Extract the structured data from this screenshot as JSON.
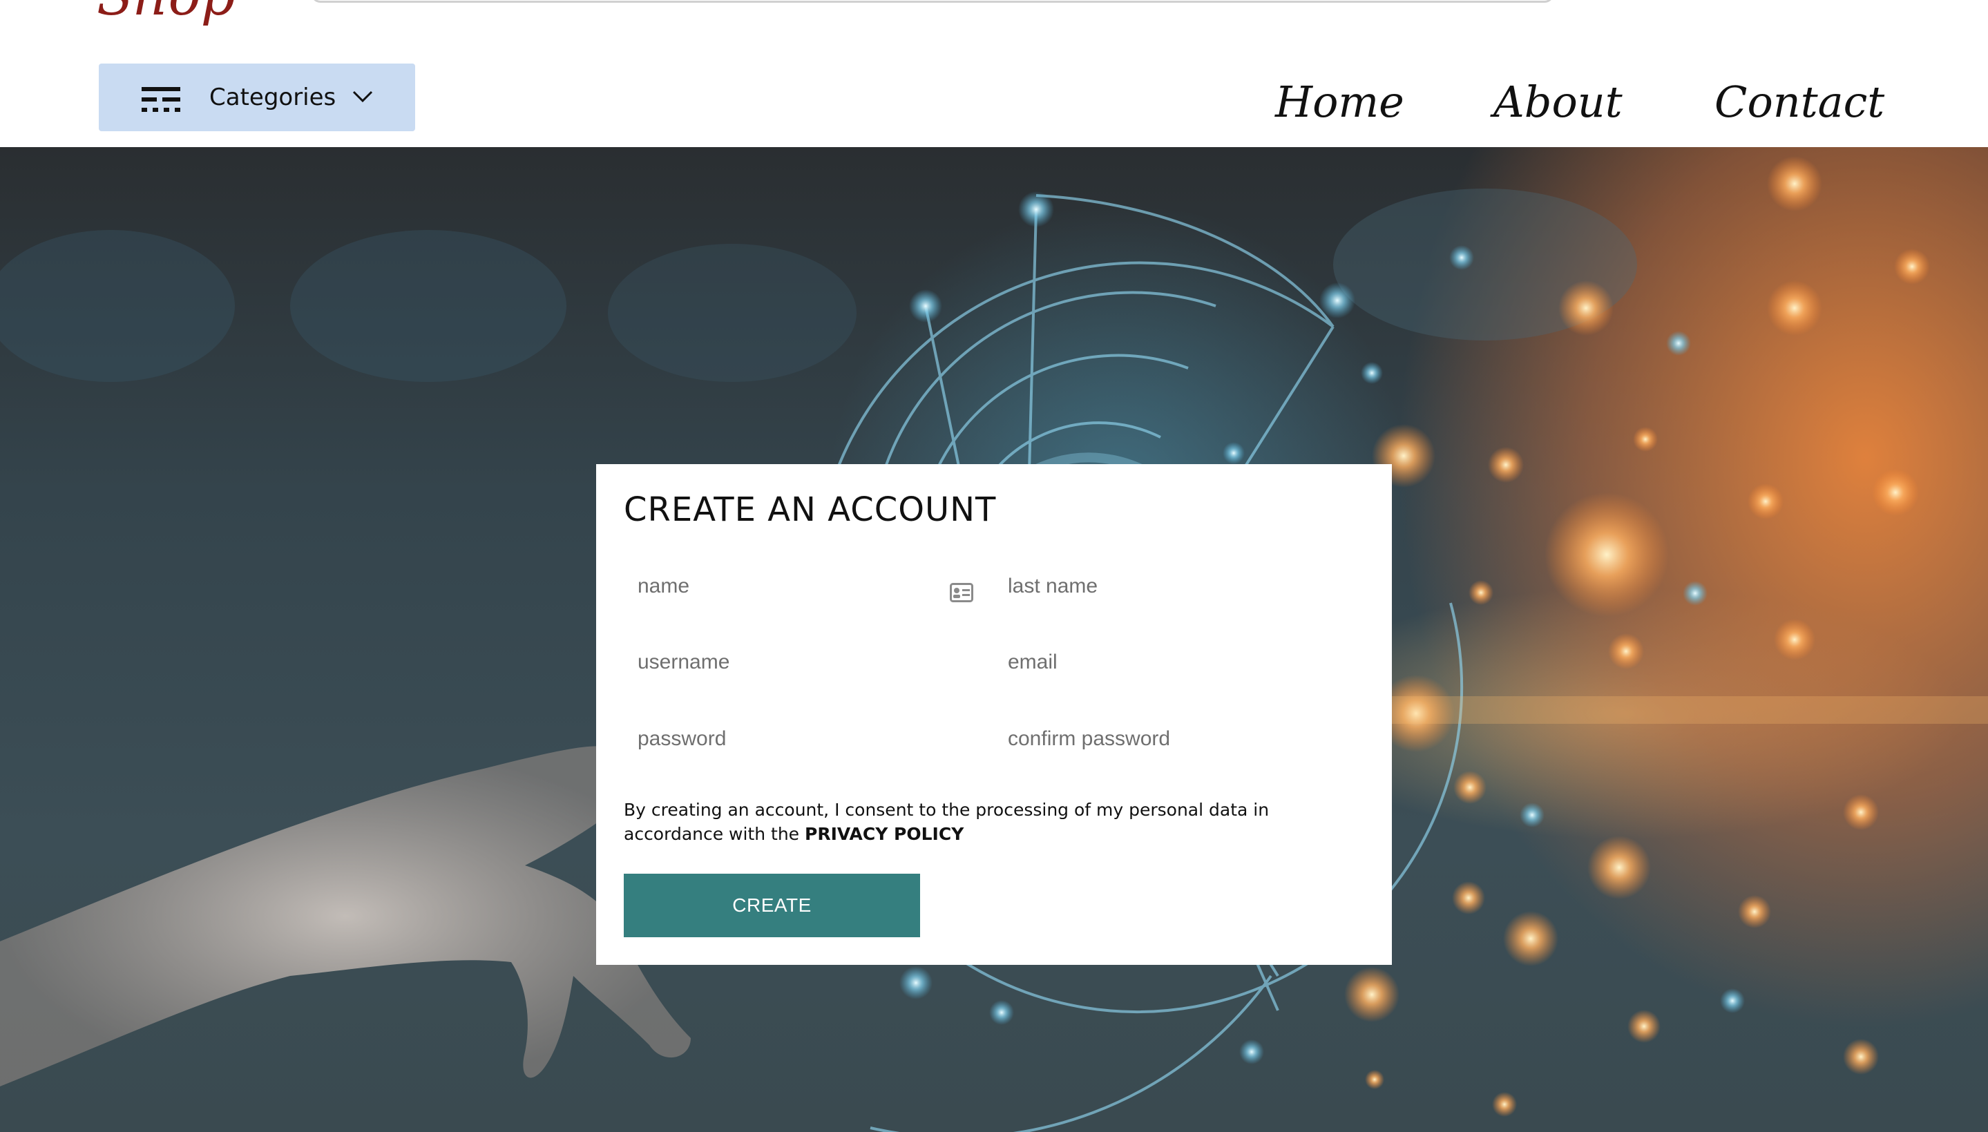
{
  "header": {
    "logo_text": "Shop",
    "search_placeholder": "",
    "categories_label": "Categories",
    "nav": {
      "home": "Home",
      "about": "About",
      "contact": "Contact"
    }
  },
  "form": {
    "title": "CREATE AN ACCOUNT",
    "fields": {
      "name_placeholder": "name",
      "last_name_placeholder": "last name",
      "username_placeholder": "username",
      "email_placeholder": "email",
      "password_placeholder": "password",
      "confirm_password_placeholder": "confirm password"
    },
    "consent_text": "By creating an account, I consent to the processing of my personal data in accordance with the ",
    "privacy_link": "PRIVACY POLICY",
    "create_label": "CREATE"
  },
  "icons": {
    "categories": "filter-icon",
    "dropdown": "chevron-down-icon",
    "name_field": "id-card-icon"
  },
  "colors": {
    "logo": "#8c1d18",
    "categories_bg": "#c9dbf2",
    "create_button": "#357f7f",
    "card_bg": "#ffffff"
  }
}
